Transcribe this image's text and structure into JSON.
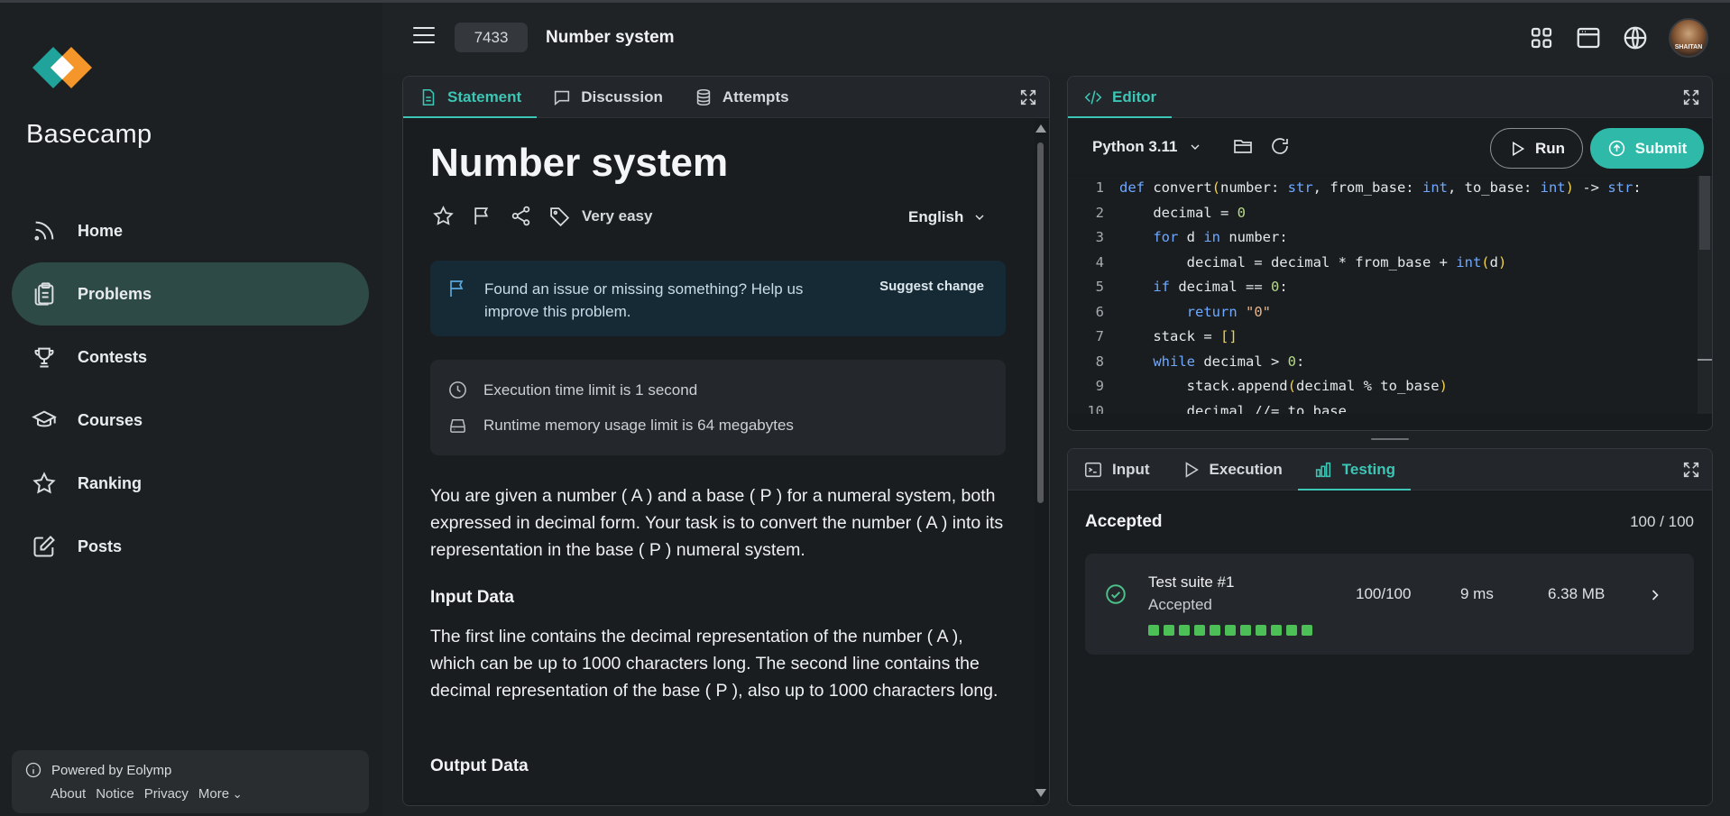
{
  "app": {
    "brand": "Basecamp"
  },
  "sidebar": {
    "items": [
      {
        "label": "Home",
        "icon": "rss-icon",
        "active": false
      },
      {
        "label": "Problems",
        "icon": "clipboard-icon",
        "active": true
      },
      {
        "label": "Contests",
        "icon": "trophy-icon",
        "active": false
      },
      {
        "label": "Courses",
        "icon": "graduation-cap-icon",
        "active": false
      },
      {
        "label": "Ranking",
        "icon": "star-icon",
        "active": false
      },
      {
        "label": "Posts",
        "icon": "edit-icon",
        "active": false
      }
    ],
    "footer": {
      "powered": "Powered by Eolymp",
      "links": [
        "About",
        "Notice",
        "Privacy",
        "More"
      ]
    }
  },
  "header": {
    "problem_id": "7433",
    "problem_title": "Number system",
    "icons": [
      "apps-grid-icon",
      "browser-window-icon",
      "globe-icon",
      "avatar"
    ]
  },
  "statement": {
    "tabs": [
      {
        "label": "Statement",
        "active": true
      },
      {
        "label": "Discussion",
        "active": false
      },
      {
        "label": "Attempts",
        "active": false
      }
    ],
    "title": "Number system",
    "difficulty": "Very easy",
    "language": "English",
    "notice": {
      "text": "Found an issue or missing something? Help us improve this problem.",
      "action": "Suggest change"
    },
    "limits": {
      "time": "Execution time limit is 1 second",
      "memory": "Runtime memory usage limit is 64 megabytes"
    },
    "description": "You are given a number ( A ) and a base ( P ) for a numeral system, both expressed in decimal form. Your task is to convert the number ( A ) into its representation in the base ( P ) numeral system.",
    "input_heading": "Input Data",
    "input_text": "The first line contains the decimal representation of the number ( A ), which can be up to 1000 characters long. The second line contains the decimal representation of the base ( P ), also up to 1000 characters long.",
    "output_heading": "Output Data"
  },
  "editor": {
    "tab": "Editor",
    "language": "Python 3.11",
    "run_label": "Run",
    "submit_label": "Submit",
    "lines": [
      "def convert(number: str, from_base: int, to_base: int) -> str:",
      "    decimal = 0",
      "    for d in number:",
      "        decimal = decimal * from_base + int(d)",
      "    if decimal == 0:",
      "        return \"0\"",
      "    stack = []",
      "    while decimal > 0:",
      "        stack.append(decimal % to_base)",
      "        decimal //= to_base"
    ]
  },
  "results": {
    "tabs": [
      {
        "label": "Input",
        "active": false
      },
      {
        "label": "Execution",
        "active": false
      },
      {
        "label": "Testing",
        "active": true
      }
    ],
    "status": "Accepted",
    "score": "100 / 100",
    "suite": {
      "name": "Test suite #1",
      "status": "Accepted",
      "score": "100/100",
      "time": "9 ms",
      "memory": "6.38 MB",
      "tests_passed": 11
    }
  },
  "colors": {
    "accent": "#2fb9a8",
    "accepted": "#4cbf57",
    "active_nav_bg": "#2e4a47"
  }
}
